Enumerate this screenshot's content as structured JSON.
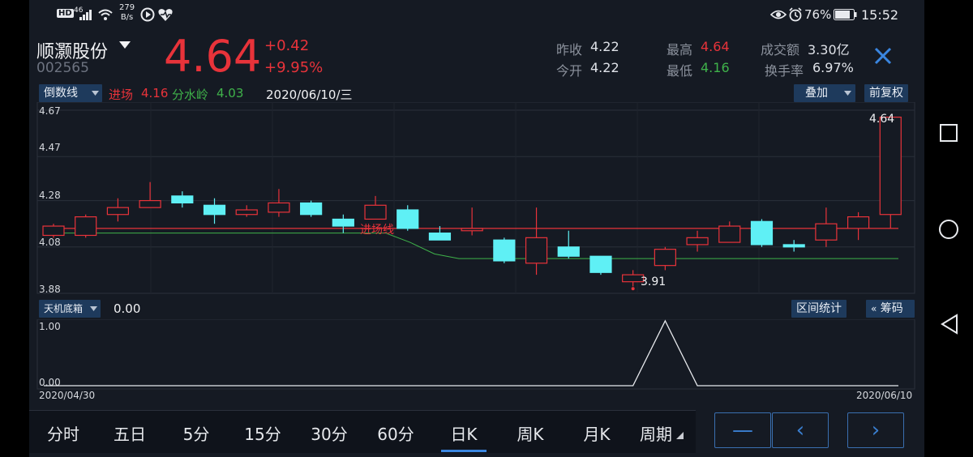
{
  "status_bar": {
    "hd": "HD",
    "net": "46",
    "speed_value": "279",
    "speed_unit": "B/s",
    "battery": "76%",
    "time": "15:52"
  },
  "stock": {
    "name": "顺灏股份",
    "code": "002565",
    "price": "4.64",
    "change": "+0.42",
    "change_pct": "+9.95%"
  },
  "quote": {
    "prev_close_label": "昨收",
    "prev_close": "4.22",
    "open_label": "今开",
    "open": "4.22",
    "high_label": "最高",
    "high": "4.64",
    "low_label": "最低",
    "low": "4.16",
    "amount_label": "成交额",
    "amount": "3.30亿",
    "turnover_label": "换手率",
    "turnover": "6.97%"
  },
  "indicator_bar": {
    "selector": "倒数线",
    "entry_label": "进场",
    "entry_value": "4.16",
    "divide_label": "分水岭",
    "divide_value": "4.03",
    "date": "2020/06/10/三",
    "overlay_button": "叠加",
    "adjust_button": "前复权"
  },
  "main_chart": {
    "y_ticks": [
      "4.67",
      "4.47",
      "4.28",
      "4.08",
      "3.88"
    ],
    "max_label": "4.64",
    "min_label": "3.91",
    "entry_line_label": "进场线"
  },
  "sub_chart": {
    "selector": "天机底箱",
    "value": "0.00",
    "stats_button": "区间统计",
    "chips_button": "筹码",
    "y_ticks": [
      "1.00",
      "0.00"
    ],
    "start_date": "2020/04/30",
    "end_date": "2020/06/10"
  },
  "chart_data": {
    "type": "candlestick",
    "ylim": [
      3.88,
      4.67
    ],
    "entry_line": 4.16,
    "divide_line_values": [
      4.14,
      4.14,
      4.14,
      4.14,
      4.14,
      4.14,
      4.14,
      4.14,
      4.14,
      4.14,
      4.14,
      4.14,
      4.14,
      4.14,
      4.14,
      4.1,
      4.05,
      4.03,
      4.03,
      4.03,
      4.03,
      4.03,
      4.03,
      4.03,
      4.03,
      4.03,
      4.03,
      4.03,
      4.03,
      4.03,
      4.03,
      4.03,
      4.03,
      4.03,
      4.03,
      4.03
    ],
    "candles": [
      {
        "o": 4.13,
        "h": 4.18,
        "l": 4.12,
        "c": 4.17
      },
      {
        "o": 4.13,
        "h": 4.22,
        "l": 4.12,
        "c": 4.21
      },
      {
        "o": 4.22,
        "h": 4.29,
        "l": 4.19,
        "c": 4.25
      },
      {
        "o": 4.25,
        "h": 4.36,
        "l": 4.25,
        "c": 4.28
      },
      {
        "o": 4.3,
        "h": 4.32,
        "l": 4.25,
        "c": 4.27
      },
      {
        "o": 4.26,
        "h": 4.29,
        "l": 4.18,
        "c": 4.22
      },
      {
        "o": 4.22,
        "h": 4.26,
        "l": 4.21,
        "c": 4.24
      },
      {
        "o": 4.23,
        "h": 4.33,
        "l": 4.21,
        "c": 4.27
      },
      {
        "o": 4.27,
        "h": 4.28,
        "l": 4.21,
        "c": 4.22
      },
      {
        "o": 4.2,
        "h": 4.22,
        "l": 4.14,
        "c": 4.17
      },
      {
        "o": 4.2,
        "h": 4.3,
        "l": 4.2,
        "c": 4.26
      },
      {
        "o": 4.24,
        "h": 4.26,
        "l": 4.15,
        "c": 4.16
      },
      {
        "o": 4.14,
        "h": 4.17,
        "l": 4.11,
        "c": 4.11
      },
      {
        "o": 4.15,
        "h": 4.25,
        "l": 4.13,
        "c": 4.16
      },
      {
        "o": 4.11,
        "h": 4.12,
        "l": 4.01,
        "c": 4.02
      },
      {
        "o": 4.01,
        "h": 4.25,
        "l": 3.96,
        "c": 4.12
      },
      {
        "o": 4.08,
        "h": 4.15,
        "l": 4.03,
        "c": 4.04
      },
      {
        "o": 4.04,
        "h": 4.04,
        "l": 3.96,
        "c": 3.97
      },
      {
        "o": 3.93,
        "h": 3.98,
        "l": 3.91,
        "c": 3.96
      },
      {
        "o": 4.0,
        "h": 4.08,
        "l": 3.98,
        "c": 4.07
      },
      {
        "o": 4.09,
        "h": 4.15,
        "l": 4.06,
        "c": 4.12
      },
      {
        "o": 4.1,
        "h": 4.19,
        "l": 4.1,
        "c": 4.17
      },
      {
        "o": 4.19,
        "h": 4.2,
        "l": 4.08,
        "c": 4.09
      },
      {
        "o": 4.09,
        "h": 4.11,
        "l": 4.06,
        "c": 4.08
      },
      {
        "o": 4.11,
        "h": 4.25,
        "l": 4.08,
        "c": 4.18
      },
      {
        "o": 4.16,
        "h": 4.23,
        "l": 4.11,
        "c": 4.21
      },
      {
        "o": 4.22,
        "h": 4.64,
        "l": 4.16,
        "c": 4.64
      }
    ],
    "sub_series": [
      0,
      0,
      0,
      0,
      0,
      0,
      0,
      0,
      0,
      0,
      0,
      0,
      0,
      0,
      0,
      0,
      0,
      0,
      0,
      1,
      0,
      0,
      0,
      0,
      0,
      0,
      0
    ]
  },
  "bottom_tabs": [
    "分时",
    "五日",
    "5分",
    "15分",
    "30分",
    "60分",
    "日K",
    "周K",
    "月K",
    "周期"
  ],
  "bottom_active": "日K",
  "nav_buttons": {
    "minus": "—",
    "prev": "‹",
    "next": "›"
  }
}
